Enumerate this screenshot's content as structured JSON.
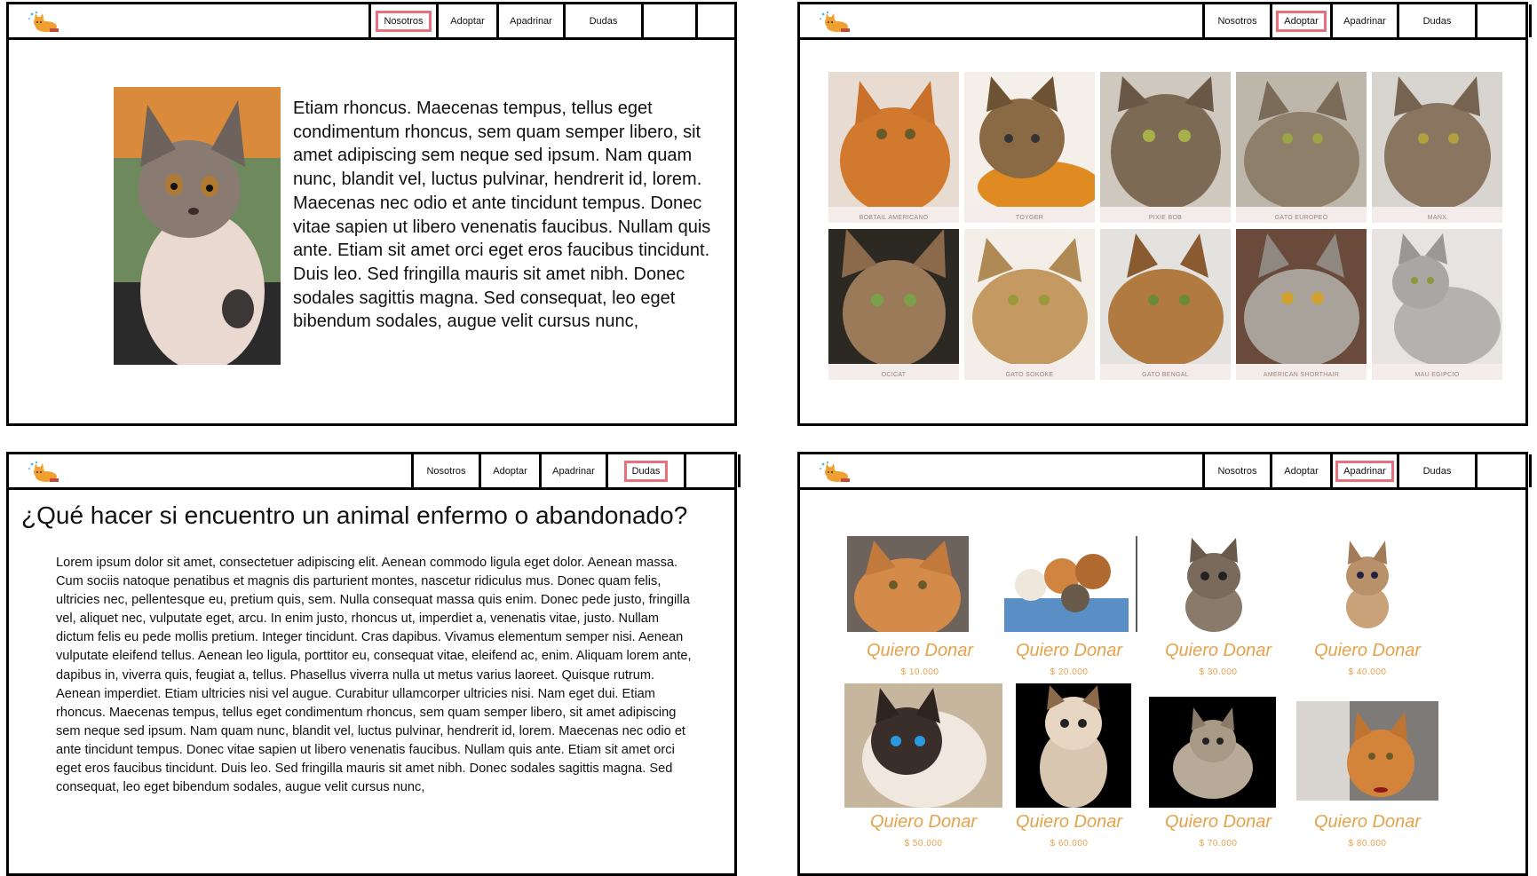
{
  "nav": {
    "items": [
      "Nosotros",
      "Adoptar",
      "Apadrinar",
      "Dudas"
    ]
  },
  "colors": {
    "active_outline": "#e8707a",
    "donate_accent": "#e6a24a"
  },
  "panels": {
    "nosotros": {
      "active_tab": "Nosotros",
      "text": "Etiam rhoncus. Maecenas tempus, tellus eget condimentum rhoncus, sem quam semper libero, sit amet adipiscing sem neque sed ipsum. Nam quam nunc, blandit vel, luctus pulvinar, hendrerit id, lorem. Maecenas nec odio et ante tincidunt tempus. Donec vitae sapien ut libero venenatis faucibus. Nullam quis ante. Etiam sit amet orci eget eros faucibus tincidunt. Duis leo. Sed fringilla mauris sit amet nibh. Donec sodales sagittis magna. Sed consequat, leo eget bibendum sodales, augue velit cursus nunc,"
    },
    "adoptar": {
      "active_tab": "Adoptar",
      "cats": [
        {
          "caption": "BOBTAIL AMERICANO"
        },
        {
          "caption": "TOYGER"
        },
        {
          "caption": "PIXIE BOB"
        },
        {
          "caption": "GATO EUROPEO"
        },
        {
          "caption": "MANX"
        },
        {
          "caption": "OCICAT"
        },
        {
          "caption": "GATO SOKOKE"
        },
        {
          "caption": "GATO BENGAL"
        },
        {
          "caption": "AMERICAN SHORTHAIR"
        },
        {
          "caption": "MAU EGIPCIO"
        }
      ]
    },
    "dudas": {
      "active_tab": "Dudas",
      "title": "¿Qué hacer si encuentro un animal enfermo o abandonado?",
      "body": "Lorem ipsum dolor sit amet, consectetuer adipiscing elit. Aenean commodo ligula eget dolor. Aenean massa. Cum sociis natoque penatibus et magnis dis parturient montes, nascetur ridiculus mus. Donec quam felis, ultricies nec, pellentesque eu, pretium quis, sem. Nulla consequat massa quis enim. Donec pede justo, fringilla vel, aliquet nec, vulputate eget, arcu. In enim justo, rhoncus ut, imperdiet a, venenatis vitae, justo. Nullam dictum felis eu pede mollis pretium. Integer tincidunt. Cras dapibus. Vivamus elementum semper nisi. Aenean vulputate eleifend tellus. Aenean leo ligula, porttitor eu, consequat vitae, eleifend ac, enim. Aliquam lorem ante, dapibus in, viverra quis, feugiat a, tellus. Phasellus viverra nulla ut metus varius laoreet. Quisque rutrum. Aenean imperdiet. Etiam ultricies nisi vel augue. Curabitur ullamcorper ultricies nisi. Nam eget dui. Etiam rhoncus. Maecenas tempus, tellus eget condimentum rhoncus, sem quam semper libero, sit amet adipiscing sem neque sed ipsum. Nam quam nunc, blandit vel, luctus pulvinar, hendrerit id, lorem. Maecenas nec odio et ante tincidunt tempus. Donec vitae sapien ut libero venenatis faucibus. Nullam quis ante. Etiam sit amet orci eget eros faucibus tincidunt. Duis leo. Sed fringilla mauris sit amet nibh. Donec sodales sagittis magna. Sed consequat, leo eget bibendum sodales, augue velit cursus nunc,"
    },
    "apadrinar": {
      "active_tab": "Apadrinar",
      "donations": [
        {
          "label": "Quiero Donar",
          "amount": "$ 10.000"
        },
        {
          "label": "Quiero Donar",
          "amount": "$ 20.000"
        },
        {
          "label": "Quiero Donar",
          "amount": "$ 30.000"
        },
        {
          "label": "Quiero Donar",
          "amount": "$ 40.000"
        },
        {
          "label": "Quiero Donar",
          "amount": "$ 50.000"
        },
        {
          "label": "Quiero Donar",
          "amount": "$ 60.000"
        },
        {
          "label": "Quiero Donar",
          "amount": "$ 70.000"
        },
        {
          "label": "Quiero Donar",
          "amount": "$ 80.000"
        }
      ]
    }
  }
}
